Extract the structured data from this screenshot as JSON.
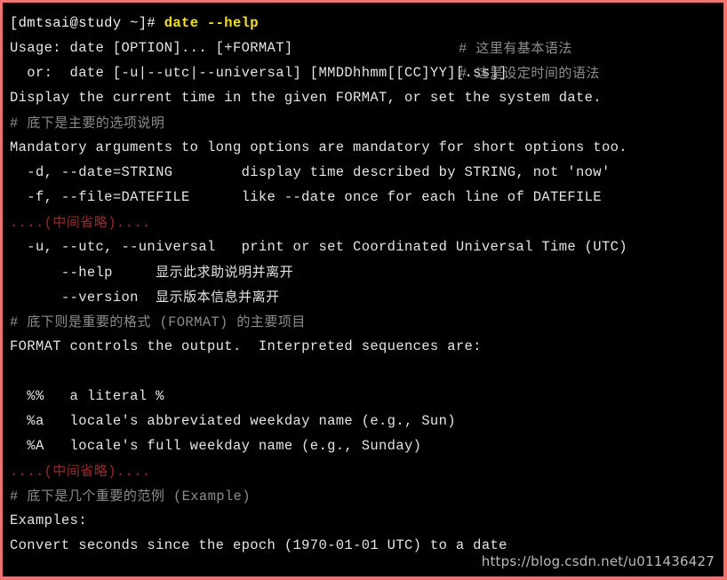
{
  "window": {
    "kind": "terminal",
    "border_color": "#f4736e",
    "background_color": "#000000",
    "default_text_color": "#e4e4e4",
    "command_color": "#f5e21c",
    "comment_color": "#8c8c8c",
    "omission_color": "#9c2b2b"
  },
  "watermark": {
    "text": "https://blog.csdn.net/u011436427"
  },
  "terminal": {
    "prompt": "[dmtsai@study ~]# ",
    "command": "date --help",
    "lines": [
      {
        "text": "Usage: date [OPTION]... [+FORMAT]",
        "style": "default",
        "annotation": "# 这里有基本语法"
      },
      {
        "text": "  or:  date [-u|--utc|--universal] [MMDDhhmm[[CC]YY][.ss]]",
        "style": "default",
        "annotation": "# 这是设定时间的语法"
      },
      {
        "text": "Display the current time in the given FORMAT, or set the system date.",
        "style": "default"
      },
      {
        "text": "# 底下是主要的选项说明",
        "style": "comment"
      },
      {
        "text": "Mandatory arguments to long options are mandatory for short options too.",
        "style": "default"
      },
      {
        "text": "  -d, --date=STRING        display time described by STRING, not 'now'",
        "style": "default"
      },
      {
        "text": "  -f, --file=DATEFILE      like --date once for each line of DATEFILE",
        "style": "default"
      },
      {
        "text": "....(中间省略)....",
        "style": "omission"
      },
      {
        "text": "  -u, --utc, --universal   print or set Coordinated Universal Time (UTC)",
        "style": "default"
      },
      {
        "text": "      --help     显示此求助说明并离开",
        "style": "default"
      },
      {
        "text": "      --version  显示版本信息并离开",
        "style": "default"
      },
      {
        "text": "# 底下则是重要的格式 (FORMAT) 的主要项目",
        "style": "comment"
      },
      {
        "text": "FORMAT controls the output.  Interpreted sequences are:",
        "style": "default"
      },
      {
        "text": "",
        "style": "blank"
      },
      {
        "text": "  %%   a literal %",
        "style": "default"
      },
      {
        "text": "  %a   locale's abbreviated weekday name (e.g., Sun)",
        "style": "default"
      },
      {
        "text": "  %A   locale's full weekday name (e.g., Sunday)",
        "style": "default"
      },
      {
        "text": "....(中间省略)....",
        "style": "omission"
      },
      {
        "text": "# 底下是几个重要的范例 (Example)",
        "style": "comment"
      },
      {
        "text": "Examples:",
        "style": "default"
      },
      {
        "text": "Convert seconds since the epoch (1970-01-01 UTC) to a date",
        "style": "default"
      }
    ]
  }
}
